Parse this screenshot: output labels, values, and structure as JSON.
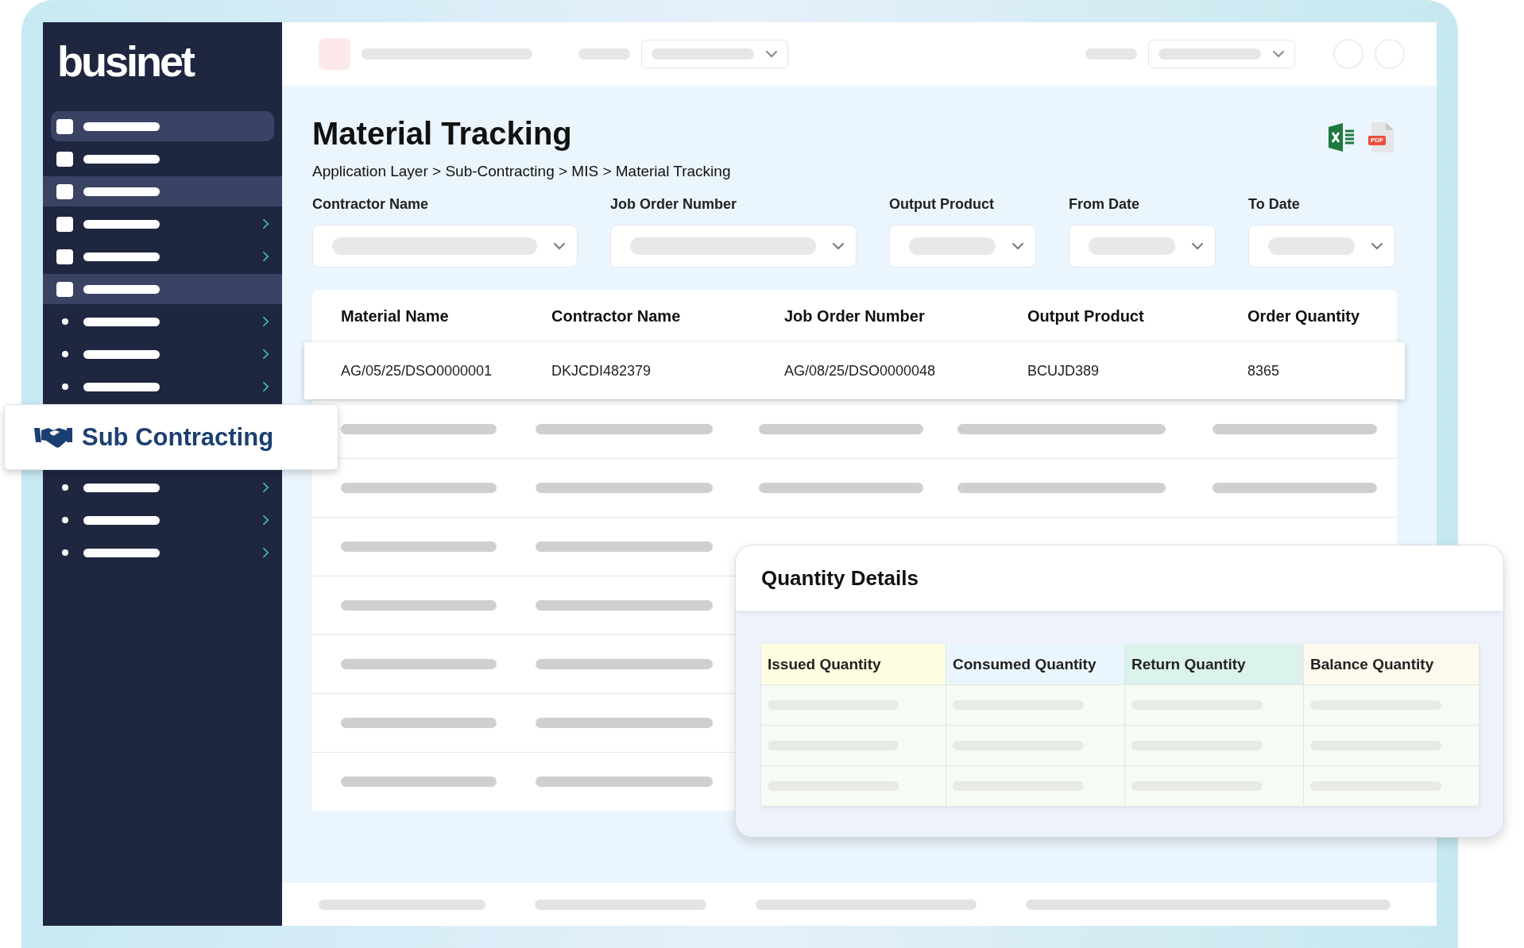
{
  "sidebar": {
    "logo": "businet",
    "items": [
      {
        "kind": "square",
        "selected": true,
        "highlighted": false,
        "arrow": false
      },
      {
        "kind": "square",
        "selected": false,
        "highlighted": false,
        "arrow": false
      },
      {
        "kind": "square",
        "selected": false,
        "highlighted": true,
        "arrow": false
      },
      {
        "kind": "square",
        "selected": false,
        "highlighted": false,
        "arrow": true
      },
      {
        "kind": "square",
        "selected": false,
        "highlighted": false,
        "arrow": true
      },
      {
        "kind": "square",
        "selected": false,
        "highlighted": true,
        "arrow": false
      },
      {
        "kind": "bullet",
        "selected": false,
        "highlighted": false,
        "arrow": true
      },
      {
        "kind": "bullet",
        "selected": false,
        "highlighted": false,
        "arrow": true
      },
      {
        "kind": "bullet",
        "selected": false,
        "highlighted": false,
        "arrow": true
      },
      {
        "kind": "callout",
        "label": "Sub Contracting"
      },
      {
        "kind": "bullet",
        "selected": false,
        "highlighted": false,
        "arrow": true
      },
      {
        "kind": "bullet",
        "selected": false,
        "highlighted": false,
        "arrow": true
      },
      {
        "kind": "bullet",
        "selected": false,
        "highlighted": false,
        "arrow": true
      }
    ]
  },
  "page": {
    "title": "Material Tracking",
    "breadcrumb": "Application Layer > Sub-Contracting > MIS > Material Tracking",
    "export": {
      "pdf_label": "PDF"
    }
  },
  "filters": [
    {
      "label": "Contractor Name"
    },
    {
      "label": "Job Order Number"
    },
    {
      "label": "Output Product"
    },
    {
      "label": "From Date"
    },
    {
      "label": "To Date"
    }
  ],
  "table": {
    "columns": [
      "Material Name",
      "Contractor Name",
      "Job Order Number",
      "Output Product",
      "Order Quantity"
    ],
    "rows": [
      [
        "AG/05/25/DSO0000001",
        "DKJCDI482379",
        "AG/08/25/DSO0000048",
        "BCUJD389",
        "8365"
      ]
    ],
    "placeholder_rows": [
      {
        "kind": "full"
      },
      {
        "kind": "full"
      },
      {
        "kind": "partial"
      },
      {
        "kind": "partial"
      },
      {
        "kind": "partial"
      },
      {
        "kind": "partial"
      },
      {
        "kind": "partial"
      }
    ]
  },
  "quantity_details": {
    "title": "Quantity Details",
    "columns": [
      {
        "label": "Issued Quantity",
        "color": "#fdfde0"
      },
      {
        "label": "Consumed Quantity",
        "color": "#eaf6fd"
      },
      {
        "label": "Return Quantity",
        "color": "#dcf2ec"
      },
      {
        "label": "Balance Quantity",
        "color": "#fdf9ec"
      }
    ],
    "placeholder_rows": [
      {
        "kind": "empty"
      },
      {
        "kind": "empty"
      },
      {
        "kind": "empty"
      }
    ]
  }
}
